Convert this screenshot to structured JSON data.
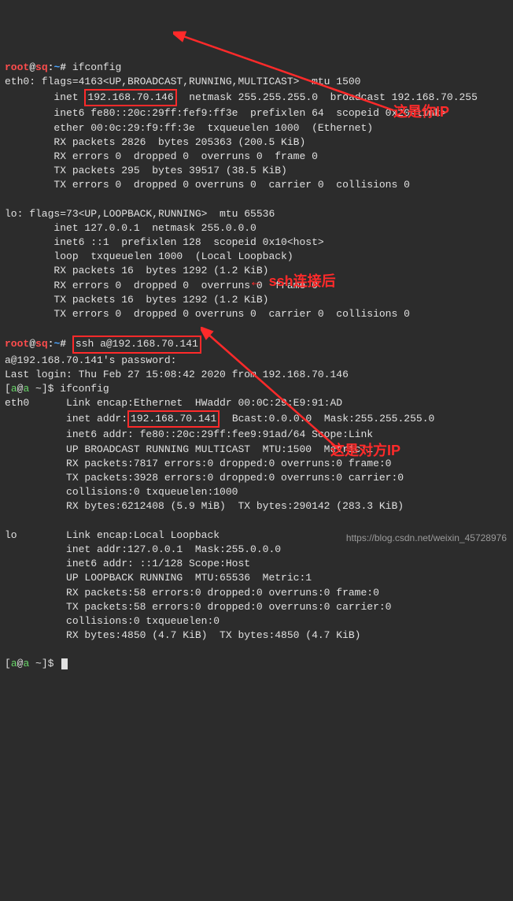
{
  "prompt1": {
    "user": "root",
    "at": "@",
    "host": "sq",
    "colon": ":",
    "tilde": "~",
    "hash": "# "
  },
  "cmd1": "ifconfig",
  "eth0_flags": "eth0: flags=4163<UP,BROADCAST,RUNNING,MULTICAST>  mtu 1500",
  "eth0_inet_pre": "        inet ",
  "eth0_inet_ip": "192.168.70.146",
  "eth0_inet_post": "  netmask 255.255.255.0  broadcast 192.168.70.255",
  "eth0_inet6": "        inet6 fe80::20c:29ff:fef9:ff3e  prefixlen 64  scopeid 0x20<link>",
  "eth0_ether": "        ether 00:0c:29:f9:ff:3e  txqueuelen 1000  (Ethernet)",
  "eth0_rxp": "        RX packets 2826  bytes 205363 (200.5 KiB)",
  "eth0_rxe": "        RX errors 0  dropped 0  overruns 0  frame 0",
  "eth0_txp": "        TX packets 295  bytes 39517 (38.5 KiB)",
  "eth0_txe": "        TX errors 0  dropped 0 overruns 0  carrier 0  collisions 0",
  "lo_flags": "lo: flags=73<UP,LOOPBACK,RUNNING>  mtu 65536",
  "lo_inet": "        inet 127.0.0.1  netmask 255.0.0.0",
  "lo_inet6": "        inet6 ::1  prefixlen 128  scopeid 0x10<host>",
  "lo_loop": "        loop  txqueuelen 1000  (Local Loopback)",
  "lo_rxp": "        RX packets 16  bytes 1292 (1.2 KiB)",
  "lo_rxe": "        RX errors 0  dropped 0  overruns 0  frame 0",
  "lo_txp": "        TX packets 16  bytes 1292 (1.2 KiB)",
  "lo_txe": "        TX errors 0  dropped 0 overruns 0  carrier 0  collisions 0",
  "cmd2": "ssh a@192.168.70.141",
  "ssh_pw": "a@192.168.70.141's password: ",
  "ssh_last": "Last login: Thu Feb 27 15:08:42 2020 from 192.168.70.146",
  "prompt3": {
    "user": "a",
    "at": "@",
    "host": "a",
    "tail": " ~]$ "
  },
  "cmd3": "ifconfig",
  "r_eth0": "eth0      Link encap:Ethernet  HWaddr 00:0C:29:E9:91:AD  ",
  "r_inet_pre": "          inet addr:",
  "r_inet_ip": "192.168.70.141",
  "r_inet_post": "  Bcast:0.0.0.0  Mask:255.255.255.0",
  "r_inet6": "          inet6 addr: fe80::20c:29ff:fee9:91ad/64 Scope:Link",
  "r_up": "          UP BROADCAST RUNNING MULTICAST  MTU:1500  Metric:1",
  "r_rxp": "          RX packets:7817 errors:0 dropped:0 overruns:0 frame:0",
  "r_txp": "          TX packets:3928 errors:0 dropped:0 overruns:0 carrier:0",
  "r_col": "          collisions:0 txqueuelen:1000 ",
  "r_bytes": "          RX bytes:6212408 (5.9 MiB)  TX bytes:290142 (283.3 KiB)",
  "r_lo": "lo        Link encap:Local Loopback  ",
  "r_lo_inet": "          inet addr:127.0.0.1  Mask:255.0.0.0",
  "r_lo_inet6": "          inet6 addr: ::1/128 Scope:Host",
  "r_lo_up": "          UP LOOPBACK RUNNING  MTU:65536  Metric:1",
  "r_lo_rxp": "          RX packets:58 errors:0 dropped:0 overruns:0 frame:0",
  "r_lo_txp": "          TX packets:58 errors:0 dropped:0 overruns:0 carrier:0",
  "r_lo_col": "          collisions:0 txqueuelen:0 ",
  "r_lo_bytes": "          RX bytes:4850 (4.7 KiB)  TX bytes:4850 (4.7 KiB)",
  "ann1": "这是你IP",
  "ann2": "ssh连接后",
  "ann3": "这是对方IP",
  "prompt4_pre": "[",
  "watermark": "https://blog.csdn.net/weixin_45728976"
}
